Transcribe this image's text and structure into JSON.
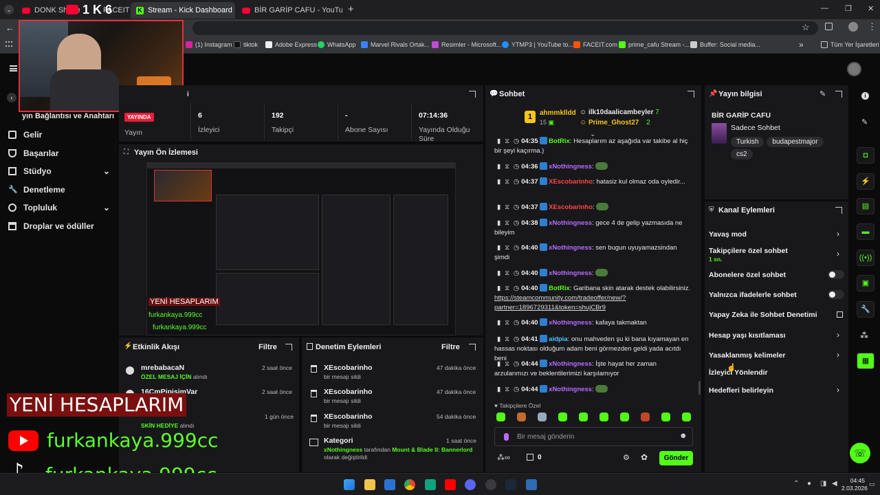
{
  "tabs": [
    {
      "label": "DONK Shatte",
      "active": false
    },
    {
      "label": "FACEIT",
      "active": false
    },
    {
      "label": "Stream - Kick Dashboard",
      "active": true
    },
    {
      "label": "BİR GARİP CAFU - YouTube",
      "active": false
    }
  ],
  "bookmarks": [
    {
      "label": "(1) Instagram"
    },
    {
      "label": "tiktok"
    },
    {
      "label": "Adobe Express"
    },
    {
      "label": "WhatsApp"
    },
    {
      "label": "Marvel Rivals Ortak..."
    },
    {
      "label": "Resimler - Microsoft..."
    },
    {
      "label": "YTMP3 | YouTube to..."
    },
    {
      "label": "FACEIT.com"
    },
    {
      "label": "prime_cafu Stream -..."
    },
    {
      "label": "Buffer: Social media..."
    }
  ],
  "bookmarks_more": "»",
  "bookmarks_all": "Tüm Yer İşaretleri",
  "nav": {
    "partial_title": "yın Bağlantısı ve Anahtarı",
    "items": [
      {
        "label": "Gelir",
        "icon": "chart-icon"
      },
      {
        "label": "Başarılar",
        "icon": "trophy-icon"
      },
      {
        "label": "Stüdyo",
        "icon": "studio-icon",
        "expand": "⌄"
      },
      {
        "label": "Denetleme",
        "icon": "wrench-icon"
      },
      {
        "label": "Topluluk",
        "icon": "community-icon",
        "expand": "⌄"
      },
      {
        "label": "Droplar ve ödüller",
        "icon": "gift-icon"
      }
    ]
  },
  "stats": {
    "status_badge": "YAYINDA",
    "status_label": "Yayın",
    "viewers_val": "6",
    "viewers_lbl": "İzleyici",
    "followers_val": "192",
    "followers_lbl": "Takipçi",
    "subs_val": "-",
    "subs_lbl": "Abone Sayısı",
    "uptime_val": "07:14:36",
    "uptime_lbl": "Yayında Olduğu Süre"
  },
  "preview": {
    "title": "Yayın Ön İzlemesi"
  },
  "activity": {
    "title": "Etkinlik Akışı",
    "filter": "Filtre",
    "items": [
      {
        "name": "mrebabacaN",
        "sub_hl": "ÖZEL MESAJ İÇİN",
        "sub": " alındı",
        "time": "2 saat önce"
      },
      {
        "name": "16CmPipisimVar",
        "sub_hl": "",
        "sub": "",
        "time": "2 saat önce"
      },
      {
        "name": "",
        "sub_hl": "SKİN HEDİYE",
        "sub": " alındı",
        "time": "1 gün önce"
      }
    ]
  },
  "moderation": {
    "title": "Denetim Eylemleri",
    "filter": "Filtre",
    "items": [
      {
        "name": "XEscobarinho",
        "sub": "bir mesajı sildi",
        "time": "47 dakika önce"
      },
      {
        "name": "XEscobarinho",
        "sub": "bir mesajı sildi",
        "time": "47 dakika önce"
      },
      {
        "name": "XEscobarinho",
        "sub": "bir mesajı sildi",
        "time": "54 dakika önce"
      }
    ],
    "category": {
      "name": "Kategori",
      "time": "1 saat önce",
      "user": "xNothingness",
      "mid": " tarafından ",
      "game": "Mount & Blade II: Bannerlord",
      "end": "olarak değiştirildi"
    }
  },
  "chat": {
    "title": "Sohbet",
    "top_user": "ahmmklldd",
    "top_count": "15",
    "pin_user1": "ilk10daalicambeyler",
    "pin_count1": "7",
    "pin_user2": "Prime_Ghost27",
    "pin_count2": "2",
    "messages": [
      {
        "ts": "04:35",
        "user": "BotRix",
        "color": "#53fc18",
        "text": "Hesaplarım az aşağıda var takibe al hiç bir şeyi kaçırma.)",
        "emote": false
      },
      {
        "ts": "04:36",
        "user": "xNothingness",
        "color": "#b86bff",
        "text": "",
        "emote": true
      },
      {
        "ts": "04:37",
        "user": "XEscobarinho",
        "color": "#ff4545",
        "text": "hatasiz kul olmaz oda oyledir...",
        "emote": false
      },
      {
        "ts": "04:37",
        "user": "XEscobarinho",
        "color": "#ff4545",
        "text": "",
        "emote": true
      },
      {
        "ts": "04:38",
        "user": "xNothingness",
        "color": "#b86bff",
        "text": "gece 4 de gelip yazmasıda ne bileyim",
        "emote": false
      },
      {
        "ts": "04:40",
        "user": "xNothingness",
        "color": "#b86bff",
        "text": "sen bugun uyuyamazsindan şimdi",
        "emote": false
      },
      {
        "ts": "04:40",
        "user": "xNothingness",
        "color": "#b86bff",
        "text": "",
        "emote": true
      },
      {
        "ts": "04:40",
        "user": "BotRix",
        "color": "#53fc18",
        "text": "Garibana skin atarak destek olabilirsiniz.",
        "link": "https://steamcommunity.com/tradeoffer/new/?partner=1896729311&token=shujCBr9",
        "emote": false
      },
      {
        "ts": "04:40",
        "user": "xNothingness",
        "color": "#b86bff",
        "text": "kafaya takmaktan",
        "emote": false
      },
      {
        "ts": "04:41",
        "user": "aidpia",
        "color": "#4ec3ff",
        "text": "onu mahveden şu ki bana kıyamayan en hassas noktası olduğum adam beni görmezden geldi yada acıtdı beni",
        "emote": false
      },
      {
        "ts": "04:44",
        "user": "xNothingness",
        "color": "#b86bff",
        "text": "İşte hayat her zaman arzularımızı ve beklentilerimizi karşılamıyor",
        "emote": false
      },
      {
        "ts": "04:44",
        "user": "xNothingness",
        "color": "#b86bff",
        "text": "",
        "emote": true
      }
    ],
    "followers_only": "Takipçilere Özel",
    "input_placeholder": "Bir mesaj gönderin",
    "points": "0",
    "send": "Gönder"
  },
  "stream_info": {
    "title": "Yayın bilgisi",
    "channel": "BİR GARİP CAFU",
    "category": "Sadece Sohbet",
    "tags": [
      "Turkish",
      "budapestmajor",
      "cs2"
    ]
  },
  "channel_actions": {
    "title": "Kanal Eylemleri",
    "rows": [
      {
        "label": "Yavaş mod",
        "kind": "chevron"
      },
      {
        "label": "Takipçilere özel sohbet",
        "sub": "1 sn.",
        "kind": "chevron"
      },
      {
        "label": "Abonelere özel sohbet",
        "kind": "toggle"
      },
      {
        "label": "Yalnızca ifadelerle sohbet",
        "kind": "toggle"
      },
      {
        "label": "Yapay Zeka ile Sohbet Denetimi",
        "kind": "external"
      },
      {
        "label": "Hesap yaşı kısıtlaması",
        "kind": "chevron"
      },
      {
        "label": "Yasaklanmış kelimeler",
        "kind": "chevron"
      },
      {
        "label": "İzleyici Yönlendir",
        "kind": "none"
      },
      {
        "label": "Hedefleri belirleyin",
        "kind": "chevron"
      }
    ]
  },
  "overlay": {
    "headline": "YENİ HESAPLARIM",
    "youtube": "furkankaya.999cc",
    "tiktok": "furkankaya.999cc",
    "cam_label": "1 K 6"
  },
  "clock": {
    "time": "04:45",
    "date": "2.03.2026"
  },
  "colors": {
    "kick_green": "#53fc18",
    "panel": "#18181b",
    "bg": "#0b0b0c"
  }
}
